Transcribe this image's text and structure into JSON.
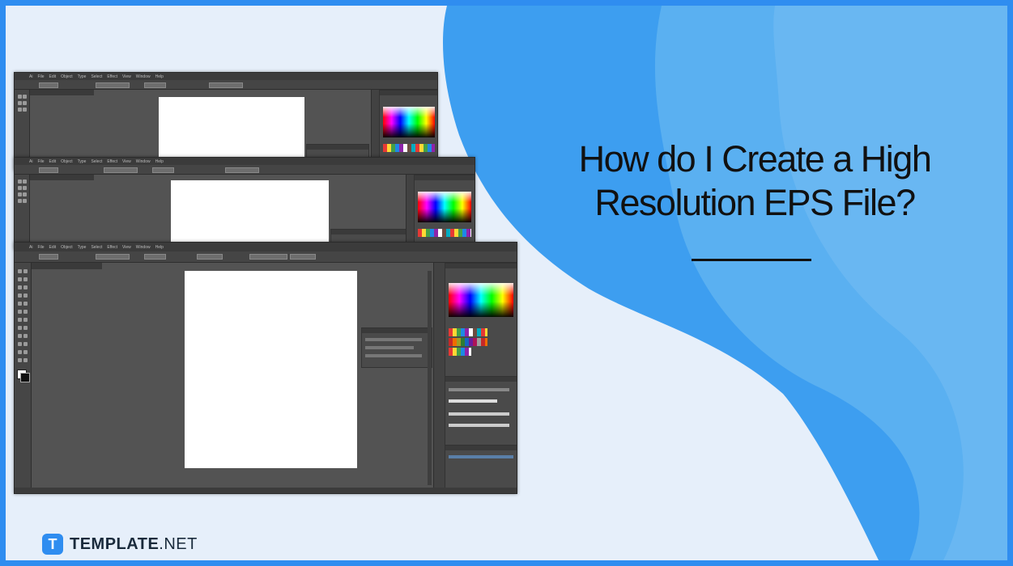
{
  "title": {
    "line1": "How do I Create a High",
    "line2": "Resolution EPS File?"
  },
  "brand": {
    "mark": "T",
    "name_bold": "TEMPLATE",
    "name_rest": ".NET"
  },
  "colors": {
    "frame_border": "#2f8df0",
    "background": "#e6effa",
    "wave_dark": "#3d9ef0",
    "wave_light": "#5cb2f2",
    "app_workspace": "#535353"
  },
  "app_menu": {
    "items": [
      "Ai",
      "File",
      "Edit",
      "Object",
      "Type",
      "Select",
      "Effect",
      "View",
      "Window",
      "Help"
    ]
  }
}
